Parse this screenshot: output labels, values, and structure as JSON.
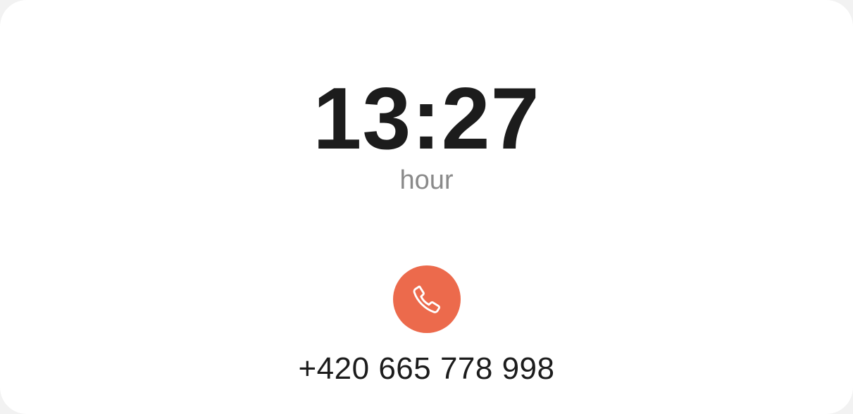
{
  "clock": {
    "time": "13:27",
    "unit_label": "hour"
  },
  "call": {
    "icon": "phone-icon",
    "button_color": "#ec6a4c",
    "icon_color": "#ffffff",
    "phone_number": "+420 665 778 998"
  }
}
